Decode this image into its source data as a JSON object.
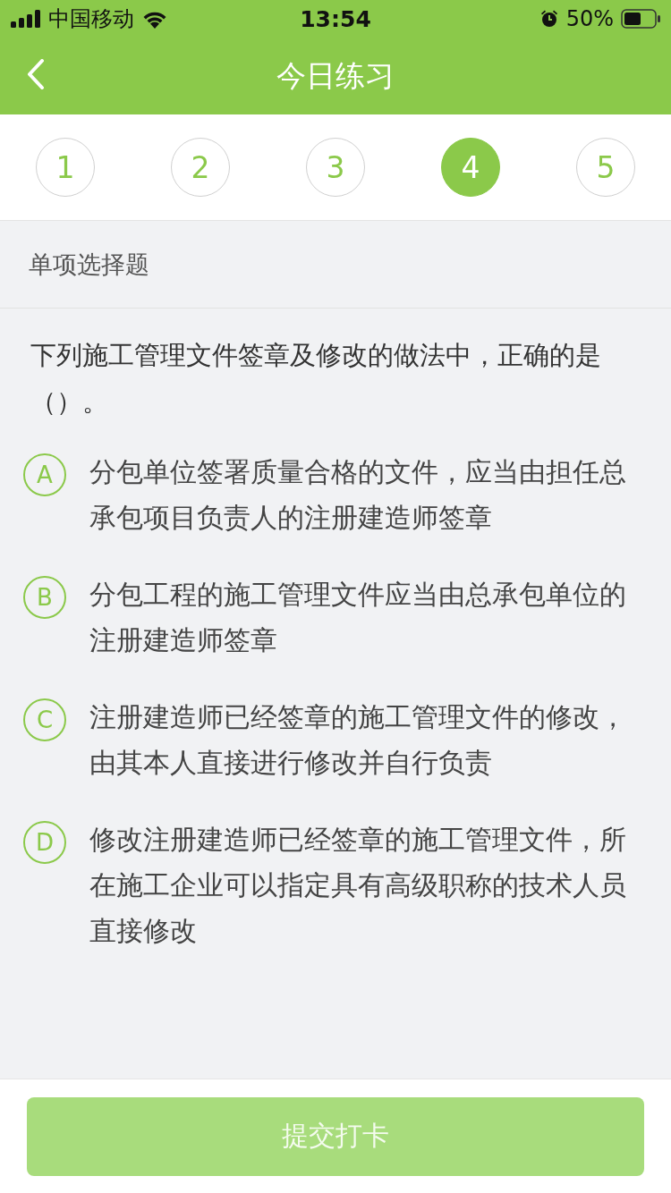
{
  "status_bar": {
    "carrier": "中国移动",
    "time": "13:54",
    "battery": "50%"
  },
  "nav": {
    "title": "今日练习"
  },
  "questions": [
    {
      "label": "1",
      "selected": false
    },
    {
      "label": "2",
      "selected": false
    },
    {
      "label": "3",
      "selected": false
    },
    {
      "label": "4",
      "selected": true
    },
    {
      "label": "5",
      "selected": false
    }
  ],
  "section_title": "单项选择题",
  "question": "下列施工管理文件签章及修改的做法中，正确的是（）。",
  "options": [
    {
      "letter": "A",
      "text": "分包单位签署质量合格的文件，应当由担任总承包项目负责人的注册建造师签章",
      "selected": false
    },
    {
      "letter": "B",
      "text": "分包工程的施工管理文件应当由总承包单位的注册建造师签章",
      "selected": false
    },
    {
      "letter": "C",
      "text": "注册建造师已经签章的施工管理文件的修改，由其本人直接进行修改并自行负责",
      "selected": false
    },
    {
      "letter": "D",
      "text": "修改注册建造师已经签章的施工管理文件，所在施工企业可以指定具有高级职称的技术人员直接修改",
      "selected": false
    }
  ],
  "submit_button": {
    "label": "提交打卡",
    "disabled": true
  }
}
